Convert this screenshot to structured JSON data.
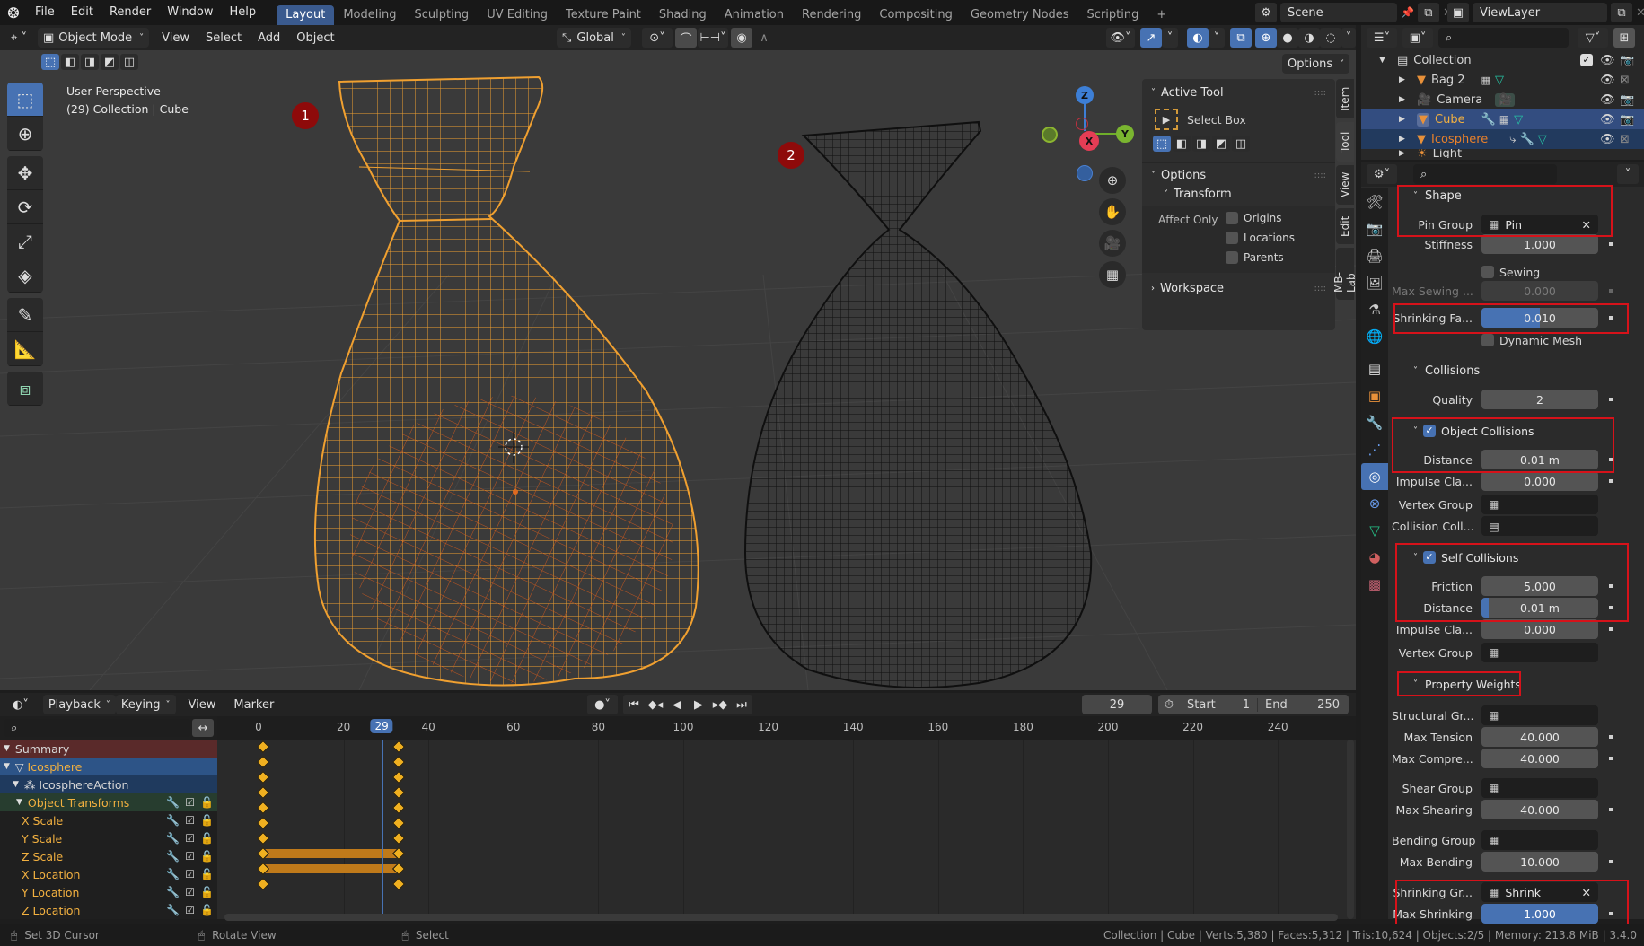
{
  "topbar": {
    "menus": [
      "File",
      "Edit",
      "Render",
      "Window",
      "Help"
    ],
    "workspaces": [
      "Layout",
      "Modeling",
      "Sculpting",
      "UV Editing",
      "Texture Paint",
      "Shading",
      "Animation",
      "Rendering",
      "Compositing",
      "Geometry Nodes",
      "Scripting"
    ],
    "active_workspace": "Layout",
    "add_workspace": "+",
    "scene": "Scene",
    "view_layer": "ViewLayer"
  },
  "viewport_header": {
    "mode": "Object Mode",
    "menus": [
      "View",
      "Select",
      "Add",
      "Object"
    ],
    "orientation": "Global",
    "options_label": "Options"
  },
  "viewport": {
    "perspective": "User Perspective",
    "context": "(29) Collection | Cube",
    "badges": [
      "1",
      "2"
    ],
    "gizmo": {
      "x": "X",
      "y": "Y",
      "z": "Z"
    },
    "colors": {
      "selected_mesh": "#f0a030",
      "active_inner": "#e06a20",
      "other_mesh": "#111111",
      "badge": "#8e0a0a"
    }
  },
  "npanel": {
    "active_tool_title": "Active Tool",
    "tool_name": "Select Box",
    "options_title": "Options",
    "transform_title": "Transform",
    "affect_only": "Affect Only",
    "affect_options": [
      {
        "label": "Origins",
        "checked": false
      },
      {
        "label": "Locations",
        "checked": false
      },
      {
        "label": "Parents",
        "checked": false
      }
    ],
    "workspace_title": "Workspace",
    "tabs": [
      "Item",
      "Tool",
      "View",
      "Edit",
      "MB-Lab"
    ],
    "active_tab": "Tool"
  },
  "outliner": {
    "root": "Collection",
    "items": [
      {
        "name": "Bag 2",
        "type": "mesh"
      },
      {
        "name": "Camera",
        "type": "camera"
      },
      {
        "name": "Cube",
        "type": "mesh",
        "selected": true
      },
      {
        "name": "Icosphere",
        "type": "mesh",
        "selected": true
      },
      {
        "name": "Light",
        "type": "light"
      }
    ]
  },
  "properties": {
    "shape": {
      "title": "Shape",
      "pin_group_label": "Pin Group",
      "pin_group_value": "Pin",
      "stiffness_label": "Stiffness",
      "stiffness_value": "1.000",
      "sewing_label": "Sewing",
      "max_sewing_label": "Max Sewing ...",
      "max_sewing_value": "0.000",
      "shrinking_label": "Shrinking Fa...",
      "shrinking_value": "0.010",
      "shrinking_fill": 0.5,
      "dynamic_mesh_label": "Dynamic Mesh"
    },
    "collisions": {
      "title": "Collisions",
      "quality_label": "Quality",
      "quality_value": "2",
      "object_title": "Object Collisions",
      "distance_label": "Distance",
      "distance_value": "0.01 m",
      "impulse_label": "Impulse Cla...",
      "impulse_value": "0.000",
      "vertex_group_label": "Vertex Group",
      "collision_coll_label": "Collision Coll...",
      "self_title": "Self Collisions",
      "friction_label": "Friction",
      "friction_value": "5.000",
      "self_distance_label": "Distance",
      "self_distance_value": "0.01 m",
      "self_distance_fill": 0.06,
      "self_impulse_label": "Impulse Cla...",
      "self_impulse_value": "0.000",
      "self_vertex_group_label": "Vertex Group"
    },
    "weights": {
      "title": "Property Weights",
      "structural_label": "Structural Gr...",
      "max_tension_label": "Max Tension",
      "max_tension_value": "40.000",
      "max_compression_label": "Max Compre...",
      "max_compression_value": "40.000",
      "shear_group_label": "Shear Group",
      "max_shearing_label": "Max Shearing",
      "max_shearing_value": "40.000",
      "bending_group_label": "Bending Group",
      "max_bending_label": "Max Bending",
      "max_bending_value": "10.000",
      "shrinking_group_label": "Shrinking Gr...",
      "shrinking_group_value": "Shrink",
      "max_shrinking_label": "Max Shrinking",
      "max_shrinking_value": "1.000"
    }
  },
  "timeline": {
    "menus": [
      "Playback",
      "Keying",
      "View",
      "Marker"
    ],
    "current_frame": "29",
    "start_label": "Start",
    "start_value": "1",
    "end_label": "End",
    "end_value": "250",
    "ruler_ticks": [
      "0",
      "20",
      "40",
      "60",
      "80",
      "100",
      "120",
      "140",
      "160",
      "180",
      "200",
      "220",
      "240"
    ],
    "channels": [
      {
        "label": "Summary",
        "kind": "summary"
      },
      {
        "label": "Icosphere",
        "kind": "object"
      },
      {
        "label": "IcosphereAction",
        "kind": "action"
      },
      {
        "label": "Object Transforms",
        "kind": "group"
      },
      {
        "label": "X Scale",
        "kind": "fcurve"
      },
      {
        "label": "Y Scale",
        "kind": "fcurve"
      },
      {
        "label": "Z Scale",
        "kind": "fcurve"
      },
      {
        "label": "X Location",
        "kind": "fcurve",
        "hold": true
      },
      {
        "label": "Y Location",
        "kind": "fcurve",
        "hold": true
      },
      {
        "label": "Z Location",
        "kind": "fcurve"
      }
    ],
    "keyframes": [
      1,
      33
    ]
  },
  "statusbar": {
    "hint1": "Set 3D Cursor",
    "hint2": "Rotate View",
    "hint3": "Select",
    "stats": "Collection | Cube | Verts:5,380 | Faces:5,312 | Tris:10,624 | Objects:2/5 | Memory: 213.8 MiB | 3.4.0"
  }
}
